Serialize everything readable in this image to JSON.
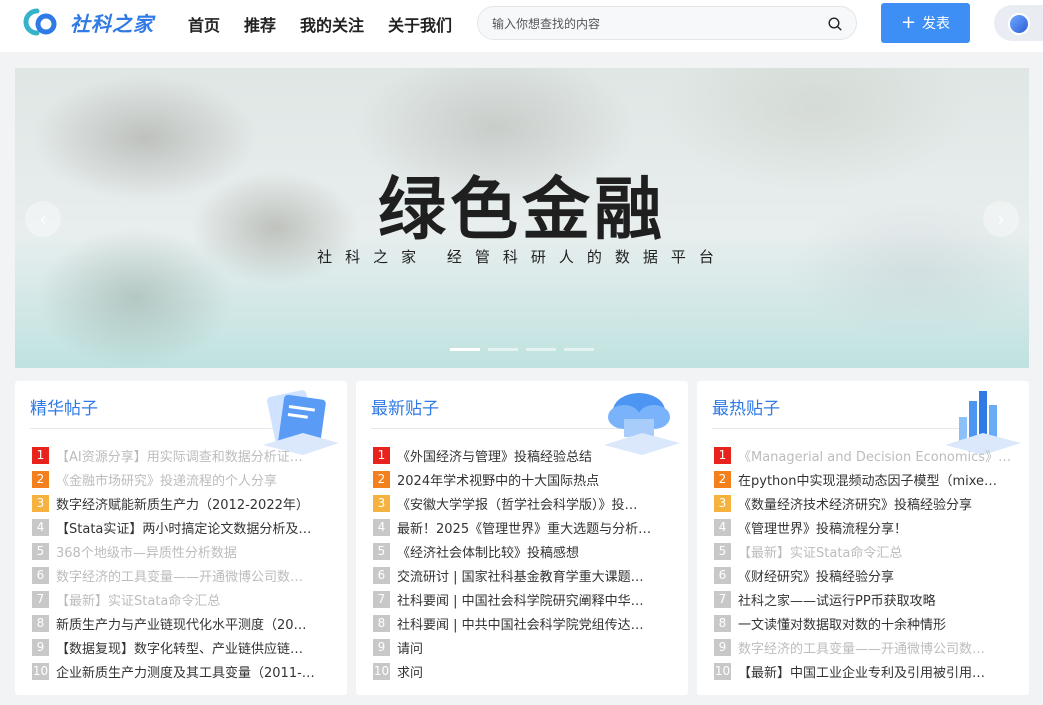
{
  "header": {
    "logo_text": "社科之家",
    "nav": [
      "首页",
      "推荐",
      "我的关注",
      "关于我们"
    ],
    "search_placeholder": "输入你想查找的内容",
    "post_label": "发表"
  },
  "banner": {
    "title": "绿色金融",
    "subtitle": "社科之家  经管科研人的数据平台",
    "slide_count": 4,
    "active_slide": 1
  },
  "sections": [
    {
      "title": "精华帖子",
      "items": [
        {
          "rank": "1",
          "text": "【AI资源分享】用实际调查和数据分析证…",
          "faded": true
        },
        {
          "rank": "2",
          "text": "《金融市场研究》投递流程的个人分享",
          "faded": true
        },
        {
          "rank": "3",
          "text": "数字经济赋能新质生产力（2012-2022年）",
          "faded": false
        },
        {
          "rank": "4",
          "text": "【Stata实证】两小时搞定论文数据分析及…",
          "faded": false
        },
        {
          "rank": "5",
          "text": "368个地级市—异质性分析数据",
          "faded": true
        },
        {
          "rank": "6",
          "text": "数字经济的工具变量——开通微博公司数…",
          "faded": true
        },
        {
          "rank": "7",
          "text": "【最新】实证Stata命令汇总",
          "faded": true
        },
        {
          "rank": "8",
          "text": "新质生产力与产业链现代化水平测度（20…",
          "faded": false
        },
        {
          "rank": "9",
          "text": "【数据复现】数字化转型、产业链供应链…",
          "faded": false
        },
        {
          "rank": "10",
          "text": "企业新质生产力测度及其工具变量（2011-…",
          "faded": false
        }
      ]
    },
    {
      "title": "最新贴子",
      "items": [
        {
          "rank": "1",
          "text": "《外国经济与管理》投稿经验总结",
          "faded": false
        },
        {
          "rank": "2",
          "text": "2024年学术视野中的十大国际热点",
          "faded": false
        },
        {
          "rank": "3",
          "text": "《安徽大学学报（哲学社会科学版）》投…",
          "faded": false
        },
        {
          "rank": "4",
          "text": "最新！2025《管理世界》重大选题与分析…",
          "faded": false
        },
        {
          "rank": "5",
          "text": "《经济社会体制比较》投稿感想",
          "faded": false
        },
        {
          "rank": "6",
          "text": "交流研讨 | 国家社科基金教育学重大课题…",
          "faded": false
        },
        {
          "rank": "7",
          "text": "社科要闻 | 中国社会科学院研究阐释中华…",
          "faded": false
        },
        {
          "rank": "8",
          "text": "社科要闻 | 中共中国社会科学院党组传达…",
          "faded": false
        },
        {
          "rank": "9",
          "text": "请问",
          "faded": false
        },
        {
          "rank": "10",
          "text": "求问",
          "faded": false
        }
      ]
    },
    {
      "title": "最热贴子",
      "items": [
        {
          "rank": "1",
          "text": "《Managerial and Decision Economics》…",
          "faded": true
        },
        {
          "rank": "2",
          "text": "在python中实现混频动态因子模型（mixe…",
          "faded": false
        },
        {
          "rank": "3",
          "text": "《数量经济技术经济研究》投稿经验分享",
          "faded": false
        },
        {
          "rank": "4",
          "text": "《管理世界》投稿流程分享！",
          "faded": false
        },
        {
          "rank": "5",
          "text": "【最新】实证Stata命令汇总",
          "faded": true
        },
        {
          "rank": "6",
          "text": "《财经研究》投稿经验分享",
          "faded": false
        },
        {
          "rank": "7",
          "text": "社科之家——试运行PP币获取攻略",
          "faded": false
        },
        {
          "rank": "8",
          "text": "一文读懂对数据取对数的十余种情形",
          "faded": false
        },
        {
          "rank": "9",
          "text": "数字经济的工具变量——开通微博公司数…",
          "faded": true
        },
        {
          "rank": "10",
          "text": "【最新】中国工业企业专利及引用被引用…",
          "faded": false
        }
      ]
    }
  ],
  "colors": {
    "brand": "#2f7ae5",
    "post_button": "#3d8ff5",
    "rank1": "#e8231d",
    "rank2": "#f3801c",
    "rank3": "#f5b23e",
    "rank_other": "#c8c8c8"
  }
}
